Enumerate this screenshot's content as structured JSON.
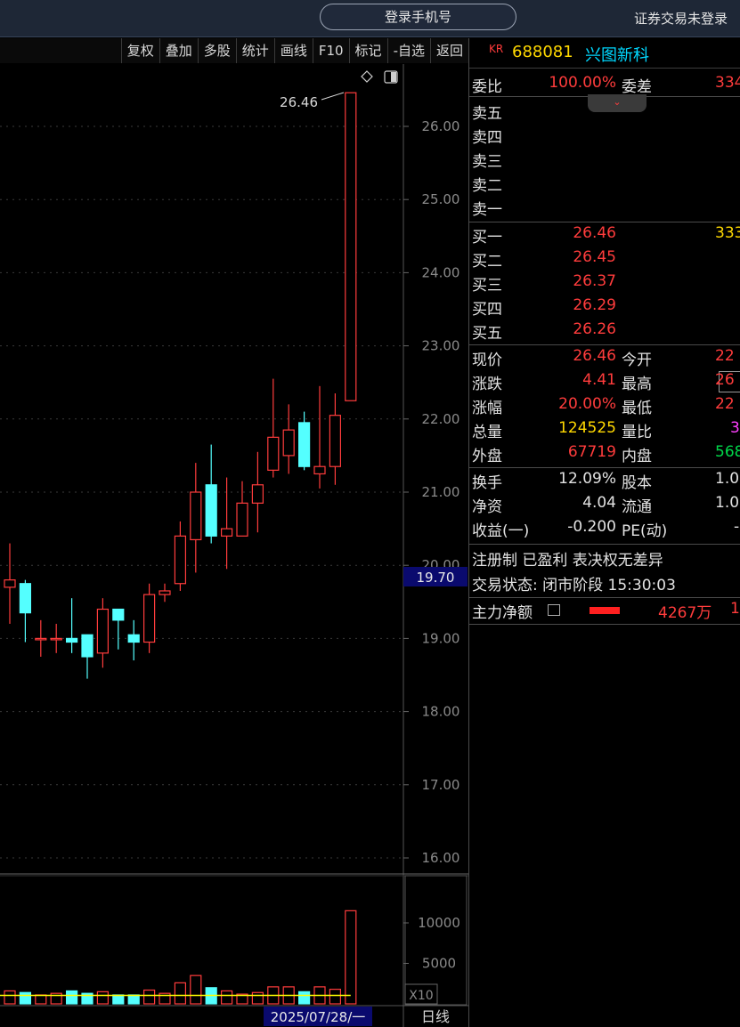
{
  "topbar": {
    "login_label": "登录手机号",
    "broker_status": "证券交易未登录"
  },
  "toolbar": {
    "items": [
      "复权",
      "叠加",
      "多股",
      "统计",
      "画线",
      "F10",
      "标记",
      "-自选",
      "返回"
    ]
  },
  "chart": {
    "price_axis": [
      "26.00",
      "25.00",
      "24.00",
      "23.00",
      "22.00",
      "21.00",
      "20.00",
      "19.00",
      "18.00",
      "17.00",
      "16.00"
    ],
    "current_marker": "19.70",
    "high_label": "26.46",
    "volume_axis": [
      "10000",
      "5000"
    ],
    "volume_unit": "X10",
    "date_label": "2025/07/28/一",
    "period_label": "日线",
    "colors": {
      "up": "#ff3c3c",
      "down": "#54ffff",
      "ma": "#ffff00",
      "axis_text": "#8a8a8a",
      "marker_bg": "#0a0a6e"
    }
  },
  "chart_data": {
    "type": "candlestick",
    "price_range": [
      15.9,
      26.5
    ],
    "volume_range": [
      0,
      12000
    ],
    "candles": [
      {
        "open": 19.7,
        "close": 19.8,
        "high": 20.3,
        "low": 19.2,
        "volume": 1600
      },
      {
        "open": 19.75,
        "close": 19.35,
        "high": 19.8,
        "low": 18.95,
        "volume": 1400
      },
      {
        "open": 19.0,
        "close": 19.0,
        "high": 19.25,
        "low": 18.75,
        "volume": 1100
      },
      {
        "open": 19.0,
        "close": 19.0,
        "high": 19.2,
        "low": 18.8,
        "volume": 1300
      },
      {
        "open": 19.0,
        "close": 18.95,
        "high": 19.55,
        "low": 18.8,
        "volume": 1600
      },
      {
        "open": 19.05,
        "close": 18.75,
        "high": 19.05,
        "low": 18.45,
        "volume": 1300
      },
      {
        "open": 18.8,
        "close": 19.4,
        "high": 19.55,
        "low": 18.6,
        "volume": 1500
      },
      {
        "open": 19.4,
        "close": 19.25,
        "high": 19.4,
        "low": 18.85,
        "volume": 1100
      },
      {
        "open": 19.05,
        "close": 18.95,
        "high": 19.25,
        "low": 18.7,
        "volume": 1100
      },
      {
        "open": 18.95,
        "close": 19.6,
        "high": 19.75,
        "low": 18.8,
        "volume": 1700
      },
      {
        "open": 19.6,
        "close": 19.65,
        "high": 19.75,
        "low": 19.5,
        "volume": 1300
      },
      {
        "open": 19.75,
        "close": 20.4,
        "high": 20.6,
        "low": 19.65,
        "volume": 2600
      },
      {
        "open": 20.35,
        "close": 21.0,
        "high": 21.4,
        "low": 19.9,
        "volume": 3500
      },
      {
        "open": 21.1,
        "close": 20.4,
        "high": 21.65,
        "low": 20.3,
        "volume": 2000
      },
      {
        "open": 20.4,
        "close": 20.5,
        "high": 21.2,
        "low": 19.95,
        "volume": 1600
      },
      {
        "open": 20.4,
        "close": 20.85,
        "high": 21.15,
        "low": 20.4,
        "volume": 1200
      },
      {
        "open": 20.85,
        "close": 21.1,
        "high": 21.55,
        "low": 20.45,
        "volume": 1400
      },
      {
        "open": 21.3,
        "close": 21.75,
        "high": 22.55,
        "low": 21.2,
        "volume": 2100
      },
      {
        "open": 21.5,
        "close": 21.85,
        "high": 22.2,
        "low": 21.25,
        "volume": 2100
      },
      {
        "open": 21.95,
        "close": 21.35,
        "high": 22.1,
        "low": 21.3,
        "volume": 1500
      },
      {
        "open": 21.25,
        "close": 21.35,
        "high": 22.45,
        "low": 21.05,
        "volume": 2100
      },
      {
        "open": 21.35,
        "close": 22.05,
        "high": 22.35,
        "low": 21.1,
        "volume": 1800
      },
      {
        "open": 22.25,
        "close": 26.46,
        "high": 26.46,
        "low": 22.25,
        "volume": 11500
      }
    ],
    "volume_ma": 1050
  },
  "panel": {
    "kr_badge": "KR",
    "code": "688081",
    "name": "兴图新科",
    "weibi_label": "委比",
    "weibi_value": "100.00%",
    "weicha_label": "委差",
    "weicha_value": "334",
    "sell": [
      {
        "label": "卖五"
      },
      {
        "label": "卖四"
      },
      {
        "label": "卖三"
      },
      {
        "label": "卖二"
      },
      {
        "label": "卖一"
      }
    ],
    "buy": [
      {
        "label": "买一",
        "price": "26.46",
        "volume": "333"
      },
      {
        "label": "买二",
        "price": "26.45",
        "volume": ""
      },
      {
        "label": "买三",
        "price": "26.37",
        "volume": ""
      },
      {
        "label": "买四",
        "price": "26.29",
        "volume": ""
      },
      {
        "label": "买五",
        "price": "26.26",
        "volume": ""
      }
    ],
    "quote": [
      {
        "l1": "现价",
        "v1": "26.46",
        "c1": "red",
        "l2": "今开",
        "v2": "22",
        "c2": "red"
      },
      {
        "l1": "涨跌",
        "v1": "4.41",
        "c1": "red",
        "l2": "最高",
        "v2": "26",
        "c2": "red"
      },
      {
        "l1": "涨幅",
        "v1": "20.00%",
        "c1": "red",
        "l2": "最低",
        "v2": "22",
        "c2": "red"
      },
      {
        "l1": "总量",
        "v1": "124525",
        "c1": "yellow",
        "l2": "量比",
        "v2": "3",
        "c2": "magenta"
      },
      {
        "l1": "外盘",
        "v1": "67719",
        "c1": "red",
        "l2": "内盘",
        "v2": "568",
        "c2": "green"
      }
    ],
    "fund": [
      {
        "l1": "换手",
        "v1": "12.09%",
        "l2": "股本",
        "v2": "1.0"
      },
      {
        "l1": "净资",
        "v1": "4.04",
        "l2": "流通",
        "v2": "1.0"
      },
      {
        "l1": "收益(一)",
        "v1": "-0.200",
        "l2": "PE(动)",
        "v2": "-"
      }
    ],
    "tags": "注册制 已盈利 表决权无差异",
    "trade_status": "交易状态: 闭市阶段 15:30:03",
    "mainflow_label": "主力净额",
    "mainflow_value": "4267万",
    "mainflow_tail": "1"
  }
}
